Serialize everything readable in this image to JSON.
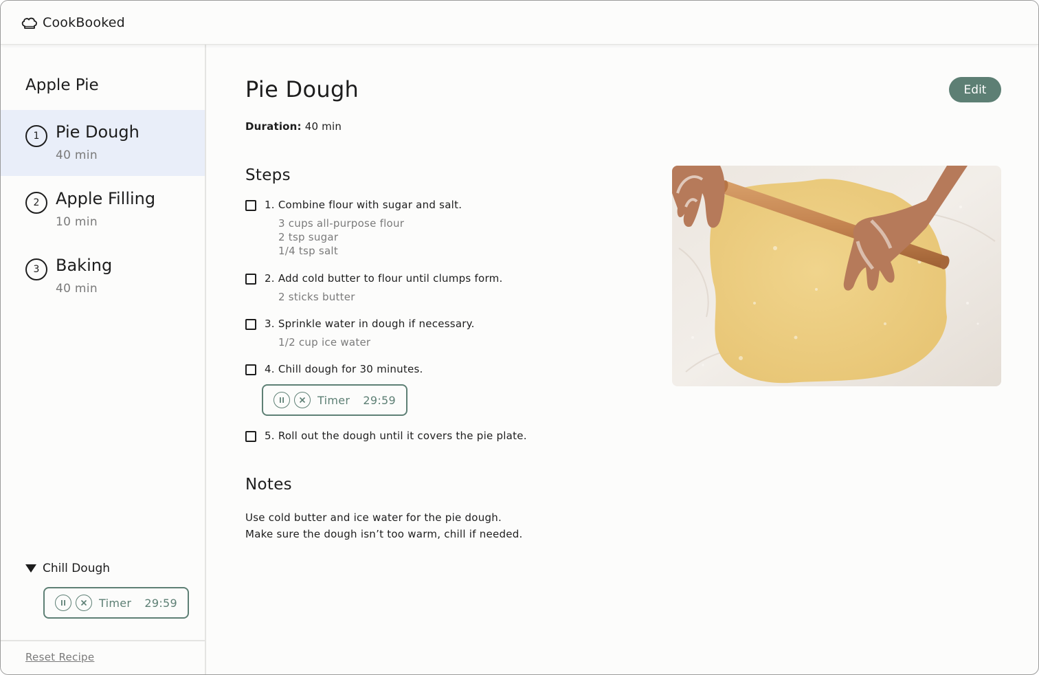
{
  "app": {
    "title": "CookBooked",
    "logo_icon": "chef-hat-icon"
  },
  "sidebar": {
    "recipe_title": "Apple Pie",
    "items": [
      {
        "number": "1",
        "name": "Pie Dough",
        "duration": "40 min",
        "active": true
      },
      {
        "number": "2",
        "name": "Apple Filling",
        "duration": "10 min",
        "active": false
      },
      {
        "number": "3",
        "name": "Baking",
        "duration": "40 min",
        "active": false
      }
    ],
    "active_timer": {
      "name": "Chill Dough",
      "label": "Timer",
      "time": "29:59"
    },
    "reset_label": "Reset Recipe"
  },
  "main": {
    "title": "Pie Dough",
    "edit_label": "Edit",
    "duration_label": "Duration:",
    "duration_value": "40 min",
    "steps_heading": "Steps",
    "steps": [
      {
        "text": "1. Combine flour with sugar and salt.",
        "ingredients": [
          "3 cups all-purpose flour",
          "2 tsp sugar",
          "1/4 tsp salt"
        ]
      },
      {
        "text": "2. Add cold butter to flour until clumps form.",
        "ingredients": [
          "2 sticks butter"
        ]
      },
      {
        "text": "3. Sprinkle water in dough if necessary.",
        "ingredients": [
          "1/2 cup ice water"
        ]
      },
      {
        "text": "4. Chill dough for 30 minutes.",
        "ingredients": [],
        "timer": {
          "label": "Timer",
          "time": "29:59"
        }
      },
      {
        "text": "5. Roll out the dough until it covers the pie plate.",
        "ingredients": []
      }
    ],
    "notes_heading": "Notes",
    "notes": [
      "Use cold butter and ice water for the pie dough.",
      "Make sure the dough isn’t too warm, chill if needed."
    ]
  },
  "colors": {
    "accent": "#5d7f74",
    "active_bg": "#e9eef9",
    "muted_text": "#7a7a7a",
    "background": "#fcfcfb"
  }
}
